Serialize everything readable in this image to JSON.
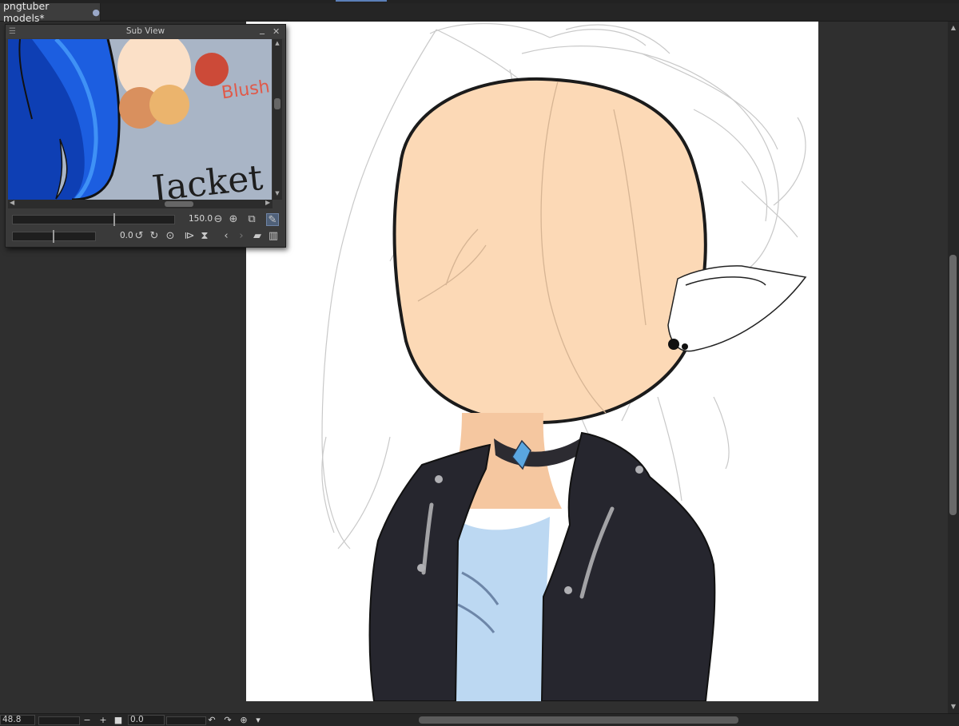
{
  "document_tab": {
    "title": "pngtuber models*",
    "modified_marker": "●"
  },
  "subview": {
    "title": "Sub View",
    "reference_text": {
      "blush": "Blush",
      "jacket": "Jacket"
    },
    "zoom_value": "150.0",
    "rotation_value": "0.0"
  },
  "statusbar": {
    "zoom_value": "48.8",
    "rotation_value": "0.0"
  },
  "colors": {
    "skin": "#fcd9b6",
    "skin_shadow": "#f4c9a2",
    "jacket": "#26262e",
    "shirt": "#bcd8f2",
    "choker": "#2c2b31",
    "gem": "#5aa6e0",
    "blush_swatch": "#cc4a38",
    "swatch_orange": "#d9905e",
    "swatch_light": "#ebb46d",
    "swatch_pale": "#fbe0c7",
    "subview_bg": "#a9b5c6"
  },
  "icons": [
    "hamburger-menu-icon",
    "minimize-icon",
    "close-icon",
    "zoom-out-icon",
    "zoom-in-icon",
    "fit-window-icon",
    "eyedropper-icon",
    "rotate-left-icon",
    "rotate-right-icon",
    "reset-rotation-icon",
    "flip-horizontal-icon",
    "flip-vertical-icon",
    "previous-image-icon",
    "next-image-icon",
    "open-folder-icon",
    "delete-icon"
  ]
}
